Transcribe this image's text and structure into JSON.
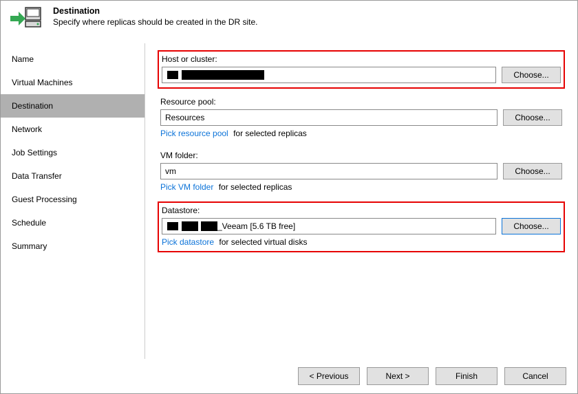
{
  "header": {
    "title": "Destination",
    "subtitle": "Specify where replicas should be created in the DR site."
  },
  "sidebar": {
    "items": [
      {
        "label": "Name"
      },
      {
        "label": "Virtual Machines"
      },
      {
        "label": "Destination",
        "selected": true
      },
      {
        "label": "Network"
      },
      {
        "label": "Job Settings"
      },
      {
        "label": "Data Transfer"
      },
      {
        "label": "Guest Processing"
      },
      {
        "label": "Schedule"
      },
      {
        "label": "Summary"
      }
    ]
  },
  "content": {
    "host": {
      "label": "Host or cluster:",
      "value": "",
      "choose": "Choose..."
    },
    "pool": {
      "label": "Resource pool:",
      "value": "Resources",
      "choose": "Choose...",
      "link": "Pick resource pool",
      "link_tail": "for selected replicas"
    },
    "vmfolder": {
      "label": "VM folder:",
      "value": "vm",
      "choose": "Choose...",
      "link": "Pick VM folder",
      "link_tail": "for selected replicas"
    },
    "datastore": {
      "label": "Datastore:",
      "value": "_Veeam [5.6 TB free]",
      "choose": "Choose...",
      "link": "Pick datastore",
      "link_tail": "for selected virtual disks"
    }
  },
  "footer": {
    "previous": "< Previous",
    "next": "Next >",
    "finish": "Finish",
    "cancel": "Cancel"
  }
}
